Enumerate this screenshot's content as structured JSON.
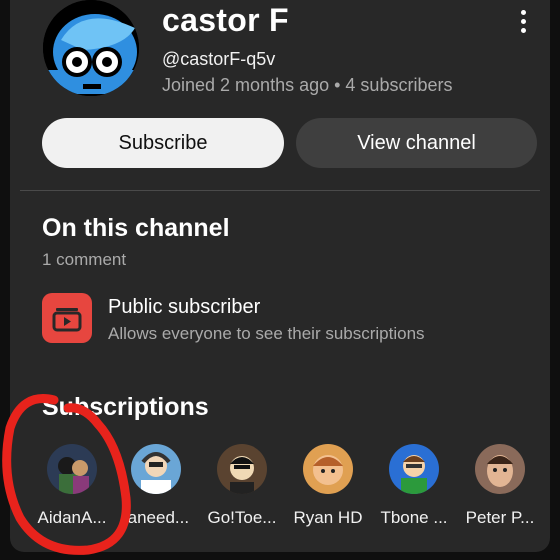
{
  "channel": {
    "name": "castor F",
    "handle": "@castorF-q5v",
    "meta": "Joined 2 months ago • 4 subscribers"
  },
  "buttons": {
    "subscribe": "Subscribe",
    "view_channel": "View channel"
  },
  "on_channel": {
    "title": "On this channel",
    "comments": "1 comment"
  },
  "public_subscriber": {
    "title": "Public subscriber",
    "description": "Allows everyone to see their subscriptions"
  },
  "subscriptions": {
    "title": "Subscriptions",
    "items": [
      {
        "name": "AidanA...",
        "color": "#2c3b55"
      },
      {
        "name": "Ianeed...",
        "color": "#6aa6d6"
      },
      {
        "name": "Go!Toe...",
        "color": "#5a4330"
      },
      {
        "name": "Ryan HD",
        "color": "#e0a052"
      },
      {
        "name": "Tbone ...",
        "color": "#2a6fd4"
      },
      {
        "name": "Peter P...",
        "color": "#8a6a5a"
      }
    ]
  },
  "colors": {
    "background": "#0f0f0f",
    "card": "#282828",
    "accent_red": "#e7463f",
    "annotation": "#e8231c"
  }
}
